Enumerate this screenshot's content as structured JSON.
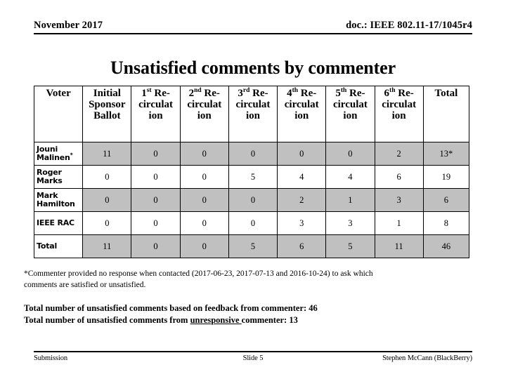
{
  "header": {
    "date": "November 2017",
    "doc": "doc.: IEEE 802.11-17/1045r4"
  },
  "title": "Unsatisfied comments by commenter",
  "table": {
    "columns": [
      {
        "key": "voter",
        "label": "Voter",
        "sup": ""
      },
      {
        "key": "isb",
        "label": "Initial Sponsor Ballot",
        "sup": ""
      },
      {
        "key": "r1",
        "label_pre": "1",
        "sup": "st",
        "label_post": " Re-circulation"
      },
      {
        "key": "r2",
        "label_pre": "2",
        "sup": "nd",
        "label_post": " Re-circulation"
      },
      {
        "key": "r3",
        "label_pre": "3",
        "sup": "rd",
        "label_post": " Re-circulation"
      },
      {
        "key": "r4",
        "label_pre": "4",
        "sup": "th",
        "label_post": " Re-circulation"
      },
      {
        "key": "r5",
        "label_pre": "5",
        "sup": "th",
        "label_post": " Re-circulation"
      },
      {
        "key": "r6",
        "label_pre": "6",
        "sup": "th",
        "label_post": " Re-circulation"
      },
      {
        "key": "total",
        "label": "Total",
        "sup": ""
      }
    ],
    "header_labels": {
      "voter": "Voter",
      "isb_line1": "Initial",
      "isb_line2": "Sponsor",
      "isb_line3": "Ballot",
      "r1_num": "1",
      "r1_sup": "st",
      "r1_re": " Re-",
      "r1_circ": "circulat",
      "r1_ion": "ion",
      "r2_num": "2",
      "r2_sup": "nd",
      "r2_re": " Re-",
      "r2_circ": "circulat",
      "r2_ion": "ion",
      "r3_num": "3",
      "r3_sup": "rd",
      "r3_re": " Re-",
      "r3_circ": "circulat",
      "r3_ion": "ion",
      "r4_num": "4",
      "r4_sup": "th",
      "r4_re": " Re-",
      "r4_circ": "circulat",
      "r4_ion": "ion",
      "r5_num": "5",
      "r5_sup": "th",
      "r5_re": " Re-",
      "r5_circ": "circulat",
      "r5_ion": "ion",
      "r6_num": "6",
      "r6_sup": "th",
      "r6_re": " Re-",
      "r6_circ": "circulat",
      "r6_ion": "ion",
      "total": "Total"
    },
    "rows": [
      {
        "name_line1": "Jouni",
        "name_line2": "Malinen",
        "name_sup": "*",
        "shaded": true,
        "values": [
          "11",
          "0",
          "0",
          "0",
          "0",
          "0",
          "2",
          "13*"
        ]
      },
      {
        "name_line1": "Roger",
        "name_line2": "Marks",
        "name_sup": "",
        "shaded": false,
        "values": [
          "0",
          "0",
          "0",
          "5",
          "4",
          "4",
          "6",
          "19"
        ]
      },
      {
        "name_line1": "Mark",
        "name_line2": "Hamilton",
        "name_sup": "",
        "shaded": true,
        "values": [
          "0",
          "0",
          "0",
          "0",
          "2",
          "1",
          "3",
          "6"
        ]
      },
      {
        "name_line1": "IEEE RAC",
        "name_line2": "",
        "name_sup": "",
        "shaded": false,
        "values": [
          "0",
          "0",
          "0",
          "0",
          "3",
          "3",
          "1",
          "8"
        ]
      },
      {
        "name_line1": "Total",
        "name_line2": "",
        "name_sup": "",
        "shaded": true,
        "values": [
          "11",
          "0",
          "0",
          "5",
          "6",
          "5",
          "11",
          "46"
        ]
      }
    ]
  },
  "footnote": {
    "line1": "*Commenter provided no response when contacted  (2017-06-23, 2017-07-13 and 2016-10-24) to ask which",
    "line2": "comments are satisfied or unsatisfied."
  },
  "totals_notes": {
    "line1": "Total number of unsatisfied comments based on feedback from commenter: 46",
    "line2_pre": "Total number of unsatisfied comments from ",
    "line2_underlined": "unresponsive ",
    "line2_post": "commenter:  13"
  },
  "footer": {
    "left": "Submission",
    "center": "Slide 5",
    "right": "Stephen McCann (BlackBerry)"
  },
  "colors": {
    "shaded_row": "#c0c0c0",
    "text": "#000000",
    "background": "#ffffff"
  }
}
